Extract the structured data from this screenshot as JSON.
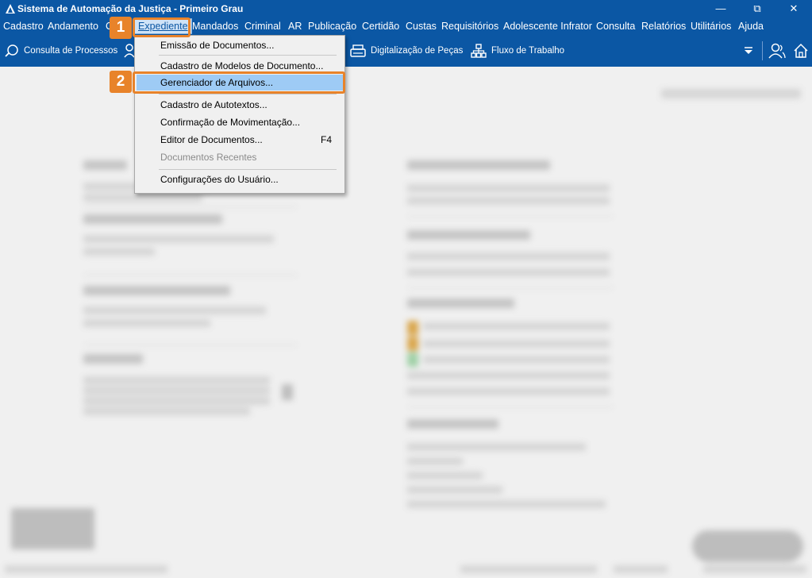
{
  "window": {
    "title": "Sistema de Automação da Justiça - Primeiro Grau",
    "controls": {
      "minimize": "—",
      "maximize": "⧉",
      "close": "✕"
    }
  },
  "menubar": {
    "items": [
      "Cadastro",
      "Andamento",
      "C",
      "Expediente",
      "Mandados",
      "Criminal",
      "AR",
      "Publicação",
      "Certidão",
      "Custas",
      "Requisitórios",
      "Adolescente Infrator",
      "Consulta",
      "Relatórios",
      "Utilitários",
      "Ajuda"
    ],
    "active": "Expediente"
  },
  "toolbar": {
    "items": [
      {
        "label": "Consulta de Processos",
        "icon": "search-process-icon"
      },
      {
        "label": "Digitalização de Peças",
        "icon": "scanner-icon"
      },
      {
        "label": "Fluxo de Trabalho",
        "icon": "workflow-icon"
      }
    ],
    "right_icons": [
      "dropdown-arrow-icon",
      "users-icon",
      "home-icon"
    ]
  },
  "dropdown": {
    "items": [
      {
        "label": "Emissão de Documentos...",
        "enabled": true
      },
      {
        "label": "Cadastro de Modelos de Documento...",
        "enabled": true
      },
      {
        "label": "Gerenciador de Arquivos...",
        "enabled": true,
        "highlighted": true
      },
      {
        "label": "Cadastro de Autotextos...",
        "enabled": true
      },
      {
        "label": "Confirmação de Movimentação...",
        "enabled": true
      },
      {
        "label": "Editor de Documentos...",
        "enabled": true,
        "shortcut": "F4"
      },
      {
        "label": "Documentos Recentes",
        "enabled": false
      },
      {
        "label": "Configurações do Usuário...",
        "enabled": true
      }
    ]
  },
  "callouts": [
    {
      "number": "1",
      "target": "Expediente"
    },
    {
      "number": "2",
      "target": "Gerenciador de Arquivos..."
    }
  ],
  "colors": {
    "titlebar": "#0b57a4",
    "highlight": "#9ecbf5",
    "callout": "#e8832a"
  }
}
